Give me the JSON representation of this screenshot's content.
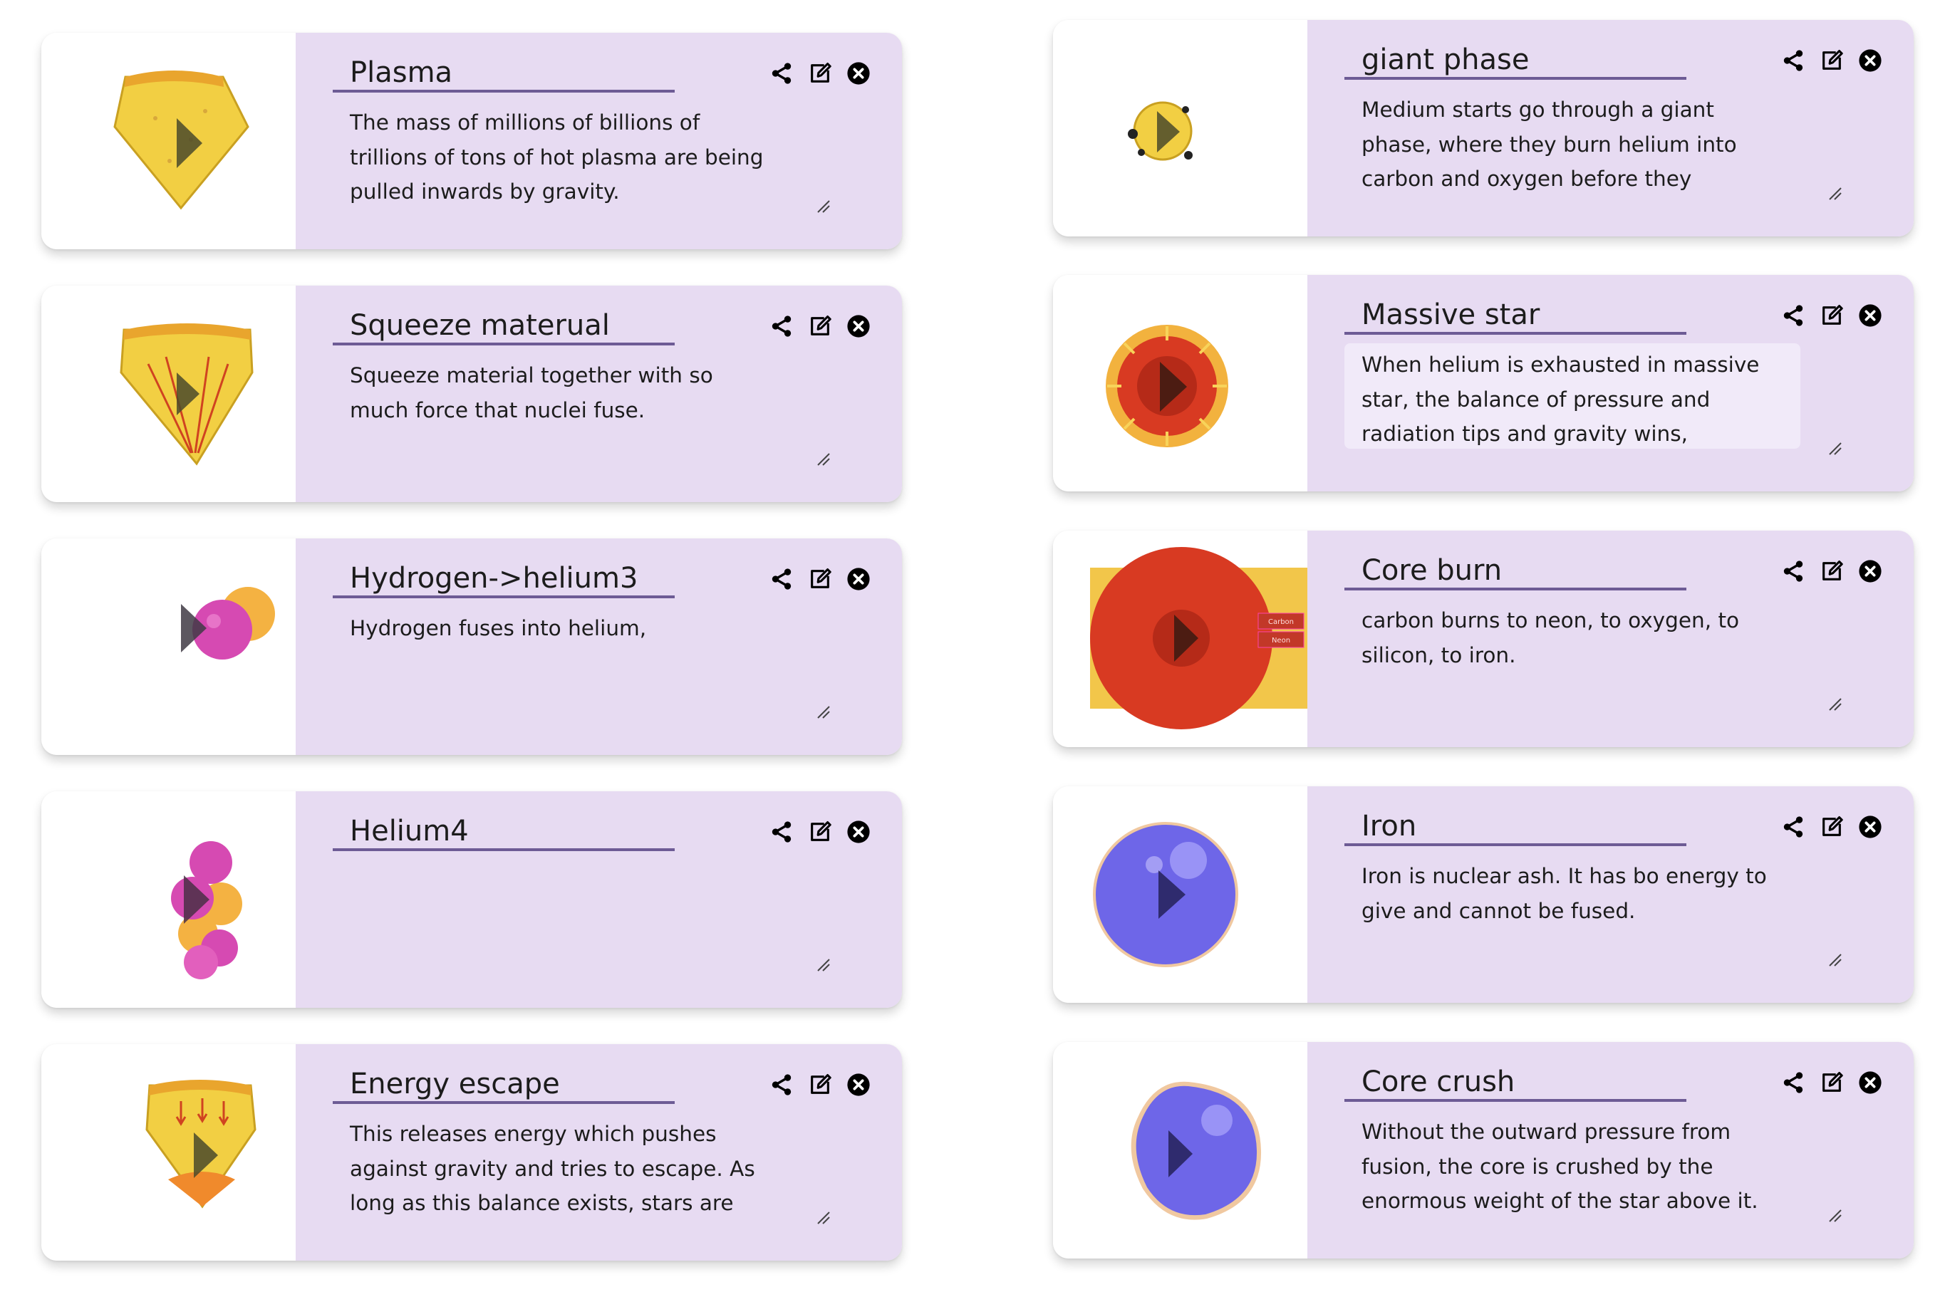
{
  "cards": [
    {
      "title": "Plasma",
      "description": "The mass of millions of billions of trillions of tons of hot plasma are being pulled inwards by gravity.",
      "thumbnail": "plasma-wedge-image"
    },
    {
      "title": "Squeeze materual",
      "description": "Squeeze material together with so much force that nuclei fuse.",
      "thumbnail": "squeeze-wedge-image"
    },
    {
      "title": "Hydrogen->helium3",
      "description": "Hydrogen fuses into helium,",
      "thumbnail": "hydrogen-fusion-image"
    },
    {
      "title": "Helium4",
      "description": "",
      "thumbnail": "helium4-cluster-image"
    },
    {
      "title": "Energy escape",
      "description": "This releases energy which pushes against gravity and tries to escape. As long as this balance exists, stars are pretty stable.",
      "thumbnail": "energy-wedge-image"
    },
    {
      "title": "giant phase",
      "description": "Medium starts go through a giant phase, where they burn helium into carbon and oxygen before they eventually turn into white",
      "thumbnail": "giant-phase-star-image"
    },
    {
      "title": "Massive star",
      "description": "When helium is exhausted in massive star, the balance of pressure and radiation tips and gravity wins, squeezing the star tighter",
      "thumbnail": "massive-star-image"
    },
    {
      "title": "Core burn",
      "description": "carbon burns to neon, to oxygen, to silicon, to iron.",
      "thumbnail": "core-burn-image",
      "thumbnail_labels": [
        "Carbon",
        "Neon"
      ]
    },
    {
      "title": "Iron",
      "description": "Iron is nuclear ash. It has bo energy to give and cannot be fused.",
      "thumbnail": "iron-sphere-image"
    },
    {
      "title": "Core crush",
      "description": "Without the outward pressure from fusion, the core is crushed by the enormous weight of the star above it.",
      "thumbnail": "core-crush-sphere-image"
    }
  ],
  "icons": {
    "share": "share-icon",
    "edit": "edit-icon",
    "delete": "close-circle-icon",
    "play": "play-icon",
    "resize": "resize-handle-icon"
  },
  "colors": {
    "panel": "#e7dbf2",
    "title_underline": "#6d5b95",
    "wedge_yellow": "#f2cf43",
    "sphere_blue": "#6e66e8",
    "helium_pink": "#d64ab2",
    "core_red": "#d83a22"
  }
}
